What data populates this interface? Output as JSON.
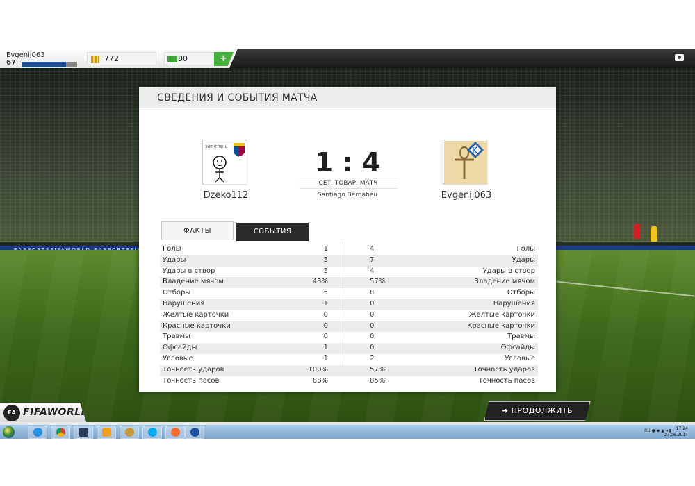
{
  "topbar": {
    "username": "Evgenij063",
    "level": "67",
    "xp_fraction": 0.8,
    "coins": "772",
    "points": "80",
    "add_label": "+"
  },
  "panel": {
    "title": "СВЕДЕНИЯ И СОБЫТИЯ МАТЧА",
    "score": "1 : 4",
    "match_type": "СЕТ. ТОВАР. МАТЧ",
    "stadium": "Santiago Bernabéu",
    "home": {
      "name": "Dzeko112",
      "crest_text": "ЗИИНГЛЯНЬ"
    },
    "away": {
      "name": "Evgenij063"
    },
    "tabs": [
      {
        "label": "ФАКТЫ",
        "active": true
      },
      {
        "label": "СОБЫТИЯ",
        "active": false
      }
    ],
    "stats": [
      {
        "label": "Голы",
        "home": "1",
        "away": "4"
      },
      {
        "label": "Удары",
        "home": "3",
        "away": "7"
      },
      {
        "label": "Удары в створ",
        "home": "3",
        "away": "4"
      },
      {
        "label": "Владение мячом",
        "home": "43%",
        "away": "57%"
      },
      {
        "label": "Отборы",
        "home": "5",
        "away": "8"
      },
      {
        "label": "Нарушения",
        "home": "1",
        "away": "0"
      },
      {
        "label": "Желтые карточки",
        "home": "0",
        "away": "0"
      },
      {
        "label": "Красные карточки",
        "home": "0",
        "away": "0"
      },
      {
        "label": "Травмы",
        "home": "0",
        "away": "0"
      },
      {
        "label": "Офсайды",
        "home": "1",
        "away": "0"
      },
      {
        "label": "Угловые",
        "home": "1",
        "away": "2"
      },
      {
        "label": "Точность ударов",
        "home": "100%",
        "away": "57%"
      },
      {
        "label": "Точность пасов",
        "home": "88%",
        "away": "85%"
      }
    ]
  },
  "continue_label": "➜  ПРОДОЛЖИТЬ",
  "logo": {
    "ea": "EA SPORTS",
    "fifa": "FIFAWORLD"
  },
  "adboard_text": "EASPORTSFIFAWORLD   EASPORTSFIFAWORLD   EASPORTSFIFAWORLD   EASPORTSFIFAWORLD   EASPORTSFIFAWORLD   EASPORTSFIFAWORLD",
  "taskbar": {
    "tray_lang": "RU",
    "time": "17:24",
    "date": "27.06.2014"
  },
  "colors": {
    "accent_green": "#45b13d",
    "xp_blue": "#1e4e8c",
    "dark_tab": "#2b2b2b"
  }
}
